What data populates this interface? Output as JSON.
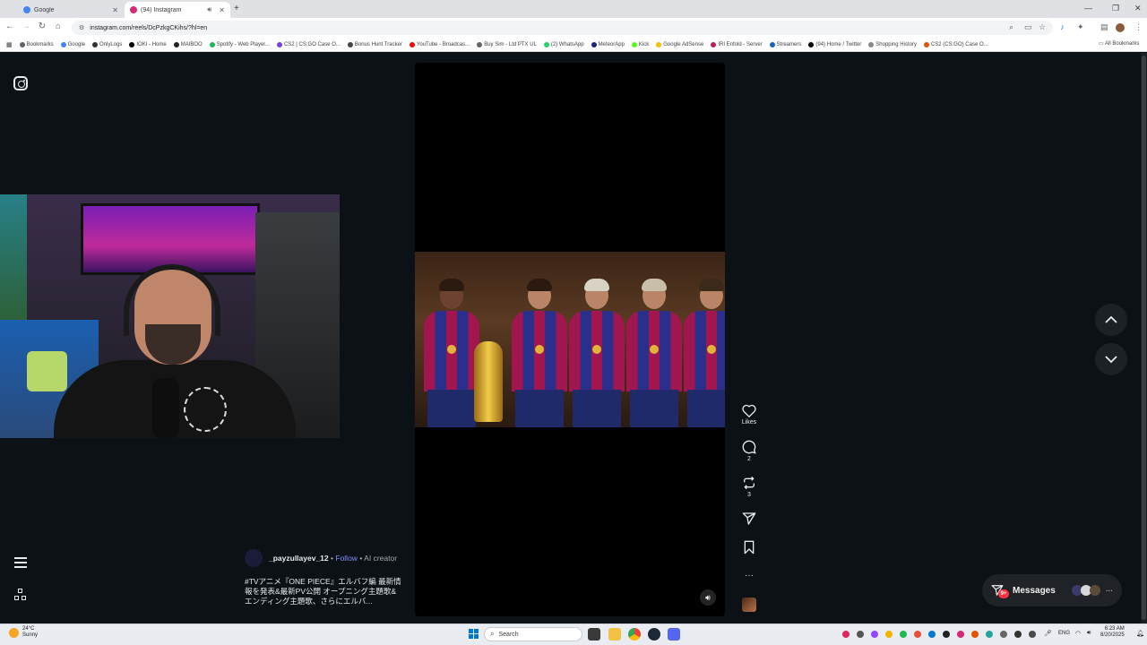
{
  "browser": {
    "tabs": [
      {
        "title": "Google",
        "active": false,
        "favicon_color": "#4285f4"
      },
      {
        "title": "(94) Instagram",
        "active": true,
        "favicon_color": "#d62976"
      }
    ],
    "new_tab_icon": "+",
    "url": "instagram.com/reels/DcPzkgCKihs/?hl=en",
    "bookmarks": [
      {
        "label": "Bookmarks",
        "color": "#5f6368"
      },
      {
        "label": "Google",
        "color": "#4285f4"
      },
      {
        "label": "OnlyLogs",
        "color": "#333333"
      },
      {
        "label": "IOKI - Home",
        "color": "#000000"
      },
      {
        "label": "MAIBOO",
        "color": "#222222"
      },
      {
        "label": "Spotify - Web Player...",
        "color": "#1db954"
      },
      {
        "label": "CS2 | CS:GO Case O...",
        "color": "#7b3fe4"
      },
      {
        "label": "Bonus Hunt Tracker",
        "color": "#444444"
      },
      {
        "label": "YouTube - Broadcas...",
        "color": "#ff0000"
      },
      {
        "label": "Buy Sim - Ltd PTX UL",
        "color": "#666666"
      },
      {
        "label": "(2) WhatsApp",
        "color": "#25d366"
      },
      {
        "label": "MeteorApp",
        "color": "#1a237e"
      },
      {
        "label": "Kick",
        "color": "#53fc18"
      },
      {
        "label": "Google AdSense",
        "color": "#fbbc04"
      },
      {
        "label": "IRI Enfold - Server",
        "color": "#c2185b"
      },
      {
        "label": "Streamers",
        "color": "#1565c0"
      },
      {
        "label": "(94) Home / Twitter",
        "color": "#000000"
      },
      {
        "label": "Shopping History",
        "color": "#888888"
      },
      {
        "label": "CS2 (CS:GO) Case O...",
        "color": "#e65100"
      }
    ],
    "all_bookmarks": "All Bookmarks"
  },
  "instagram": {
    "actions": {
      "likes_label": "Likes",
      "comments_count": "2",
      "reposts_count": "3",
      "more_label": "···"
    },
    "author": {
      "username": "_payzullayev_12",
      "separator": "•",
      "follow_label": "Follow",
      "ai_label": "• AI creator"
    },
    "caption": "#TVアニメ『ONE PIECE』エルバフ編 最新情報を発表&最新PV公開 オープニング主題歌&エンディング主題歌、さらにエルバ...",
    "messages": {
      "label": "Messages",
      "badge": "9+"
    }
  },
  "taskbar": {
    "weather_temp": "24°C",
    "weather_desc": "Sunny",
    "search_placeholder": "Search",
    "lang": "ENG",
    "time": "6:23 AM",
    "date": "8/20/2025"
  }
}
